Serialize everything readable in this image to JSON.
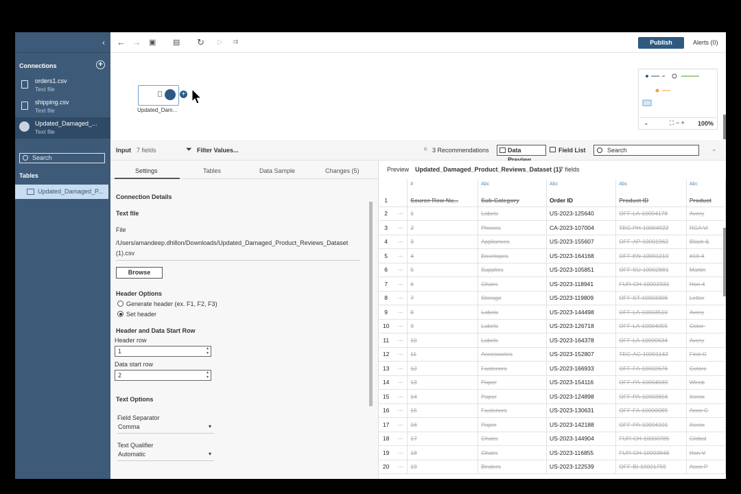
{
  "sidebar": {
    "connections_label": "Connections",
    "connections": [
      {
        "name": "orders1.csv",
        "type": "Text file"
      },
      {
        "name": "shipping.csv",
        "type": "Text file"
      },
      {
        "name": "Updated_Damaged_...",
        "type": "Text file"
      }
    ],
    "search_placeholder": "Search",
    "tables_label": "Tables",
    "table_item": "Updated_Damaged_P..."
  },
  "toolbar": {
    "publish": "Publish",
    "alerts": "Alerts (0)"
  },
  "canvas": {
    "node_label": "Updated_Dam...",
    "zoom": "100%"
  },
  "input_bar": {
    "title": "Input",
    "fields": "7 fields",
    "filter": "Filter Values...",
    "recommendations": "3 Recommendations",
    "data_preview": "Data Preview",
    "field_list": "Field List",
    "search": "Search"
  },
  "settings": {
    "tabs": [
      "Settings",
      "Tables",
      "Data Sample",
      "Changes (5)"
    ],
    "connection_details": "Connection Details",
    "text_file": "Text file",
    "file_label": "File",
    "file_path": "/Users/amandeep.dhillon/Downloads/Updated_Damaged_Product_Reviews_Dataset (1).csv",
    "browse": "Browse",
    "header_options": "Header Options",
    "generate_header": "Generate header (ex. F1, F2, F3)",
    "set_header": "Set header",
    "start_row_head": "Header and Data Start Row",
    "header_row_label": "Header row",
    "header_row": "1",
    "data_start_label": "Data start row",
    "data_start": "2",
    "text_options": "Text Options",
    "field_sep_label": "Field Separator",
    "field_sep": "Comma",
    "qualifier_label": "Text Qualifier",
    "qualifier": "Automatic"
  },
  "grid": {
    "preview": "Preview",
    "dataset": "Updated_Damaged_Product_Reviews_Dataset (1)",
    "count": "7 fields",
    "header_rownum": "1",
    "columns": [
      {
        "type": "#",
        "name": "Source Row Nu..."
      },
      {
        "type": "Abc",
        "name": "Sub-Category"
      },
      {
        "type": "Abc",
        "name": "Order ID"
      },
      {
        "type": "Abc",
        "name": "Product ID"
      },
      {
        "type": "Abc",
        "name": "Product"
      }
    ],
    "rows": [
      [
        "2",
        "1",
        "Labels",
        "US-2023-125640",
        "OFF-LA-10004178",
        "Avery"
      ],
      [
        "3",
        "2",
        "Phones",
        "CA-2023-107004",
        "TEC-PH-10004922",
        "RCA Vi"
      ],
      [
        "4",
        "3",
        "Appliances",
        "US-2023-155607",
        "OFF-AP-10001962",
        "Black &"
      ],
      [
        "5",
        "4",
        "Envelopes",
        "US-2023-164168",
        "OFF-EN-10001219",
        "#10-4"
      ],
      [
        "6",
        "5",
        "Supplies",
        "US-2023-105851",
        "OFF-SU-10002881",
        "Martin"
      ],
      [
        "7",
        "6",
        "Chairs",
        "US-2023-118941",
        "FUR-CH-10002331",
        "Hon 4"
      ],
      [
        "8",
        "7",
        "Storage",
        "US-2023-119809",
        "OFF-ST-10003306",
        "Letter"
      ],
      [
        "9",
        "8",
        "Labels",
        "US-2023-144498",
        "OFF-LA-10003510",
        "Avery"
      ],
      [
        "10",
        "9",
        "Labels",
        "US-2023-126718",
        "OFF-LA-10004055",
        "Color-"
      ],
      [
        "11",
        "10",
        "Labels",
        "US-2023-164378",
        "OFF-LA-10000634",
        "Avery"
      ],
      [
        "12",
        "11",
        "Accessories",
        "US-2023-152807",
        "TEC-AC-10001142",
        "First C"
      ],
      [
        "13",
        "12",
        "Fasteners",
        "US-2023-166933",
        "OFF-FA-10002676",
        "Colore"
      ],
      [
        "14",
        "13",
        "Paper",
        "US-2023-154116",
        "OFF-PA-10004569",
        "Wireb"
      ],
      [
        "15",
        "14",
        "Paper",
        "US-2023-124898",
        "OFF-PA-10003656",
        "Xerox"
      ],
      [
        "16",
        "15",
        "Fasteners",
        "US-2023-130631",
        "OFF-FA-10000089",
        "Acco C"
      ],
      [
        "17",
        "16",
        "Paper",
        "US-2023-142188",
        "OFF-PA-10004101",
        "Xerox"
      ],
      [
        "18",
        "17",
        "Chairs",
        "US-2023-144904",
        "FUR-CH-10000785",
        "Global"
      ],
      [
        "19",
        "18",
        "Chairs",
        "US-2023-116855",
        "FUR-CH-10003846",
        "Hon V"
      ],
      [
        "20",
        "19",
        "Binders",
        "US-2023-122539",
        "OFF-BI-10001759",
        "Acco P"
      ]
    ]
  }
}
